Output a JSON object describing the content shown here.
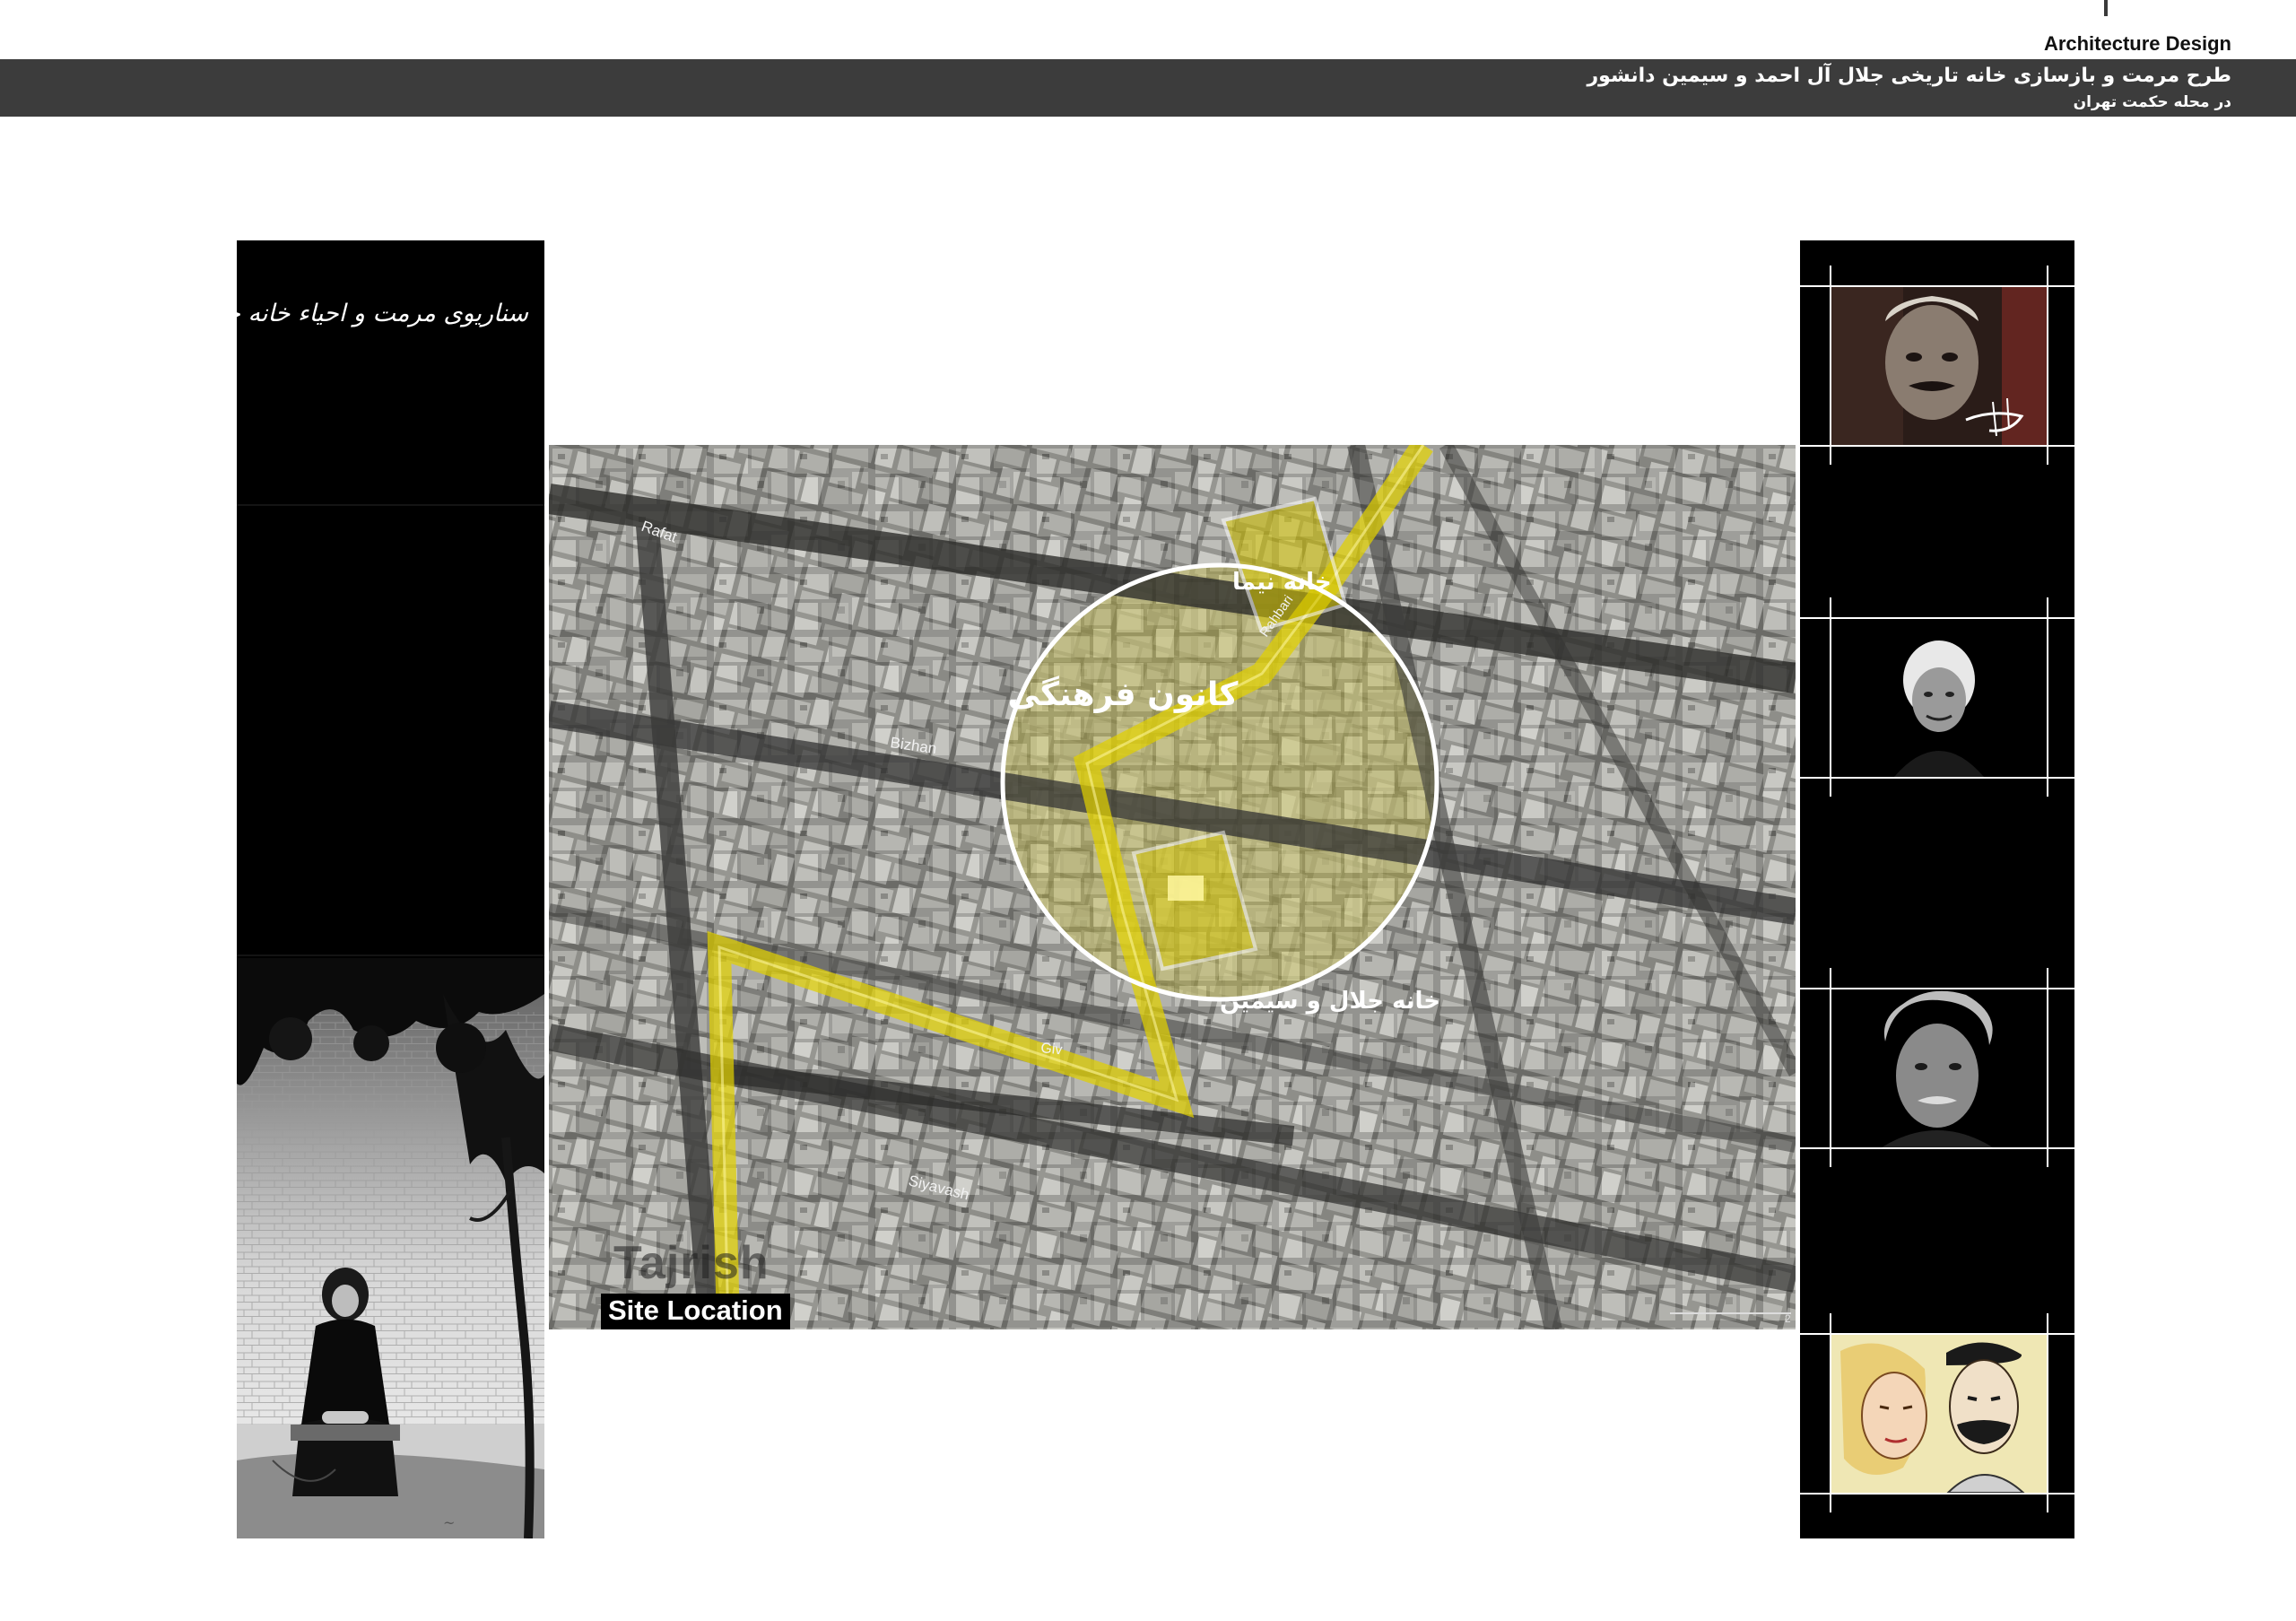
{
  "header": {
    "label": "Architecture Design",
    "title": "طرح مرمت و بازسازی خانه تاریخی جلال آل احمد و سیمین دانشور",
    "subtitle": "در محله حکمت تهران"
  },
  "left_panel": {
    "title": "سناریوی مرمت و احیاء خانه جلال و سیمین"
  },
  "map": {
    "streets": {
      "rafat": "Rafat",
      "bizhan": "Bizhan",
      "giv": "Giv",
      "siyavash": "Siyavash",
      "rahbari": "Rahbari"
    },
    "labels": {
      "nima_house": "خانه نیما",
      "cultural_center": "کانون فرهنگی",
      "jalal_simin_house": "خانه جلال و سیمین"
    },
    "tajrish": "Tajrish",
    "site_location": "Site Location",
    "scale_note": "2"
  },
  "colors": {
    "highlight": "#e0d000",
    "header_bar": "#3c3c3c"
  },
  "icons": {
    "portrait_1": "portrait-man-icon",
    "portrait_2": "portrait-woman-icon",
    "portrait_3": "portrait-elder-icon",
    "portrait_4": "portrait-sketch-icon"
  }
}
